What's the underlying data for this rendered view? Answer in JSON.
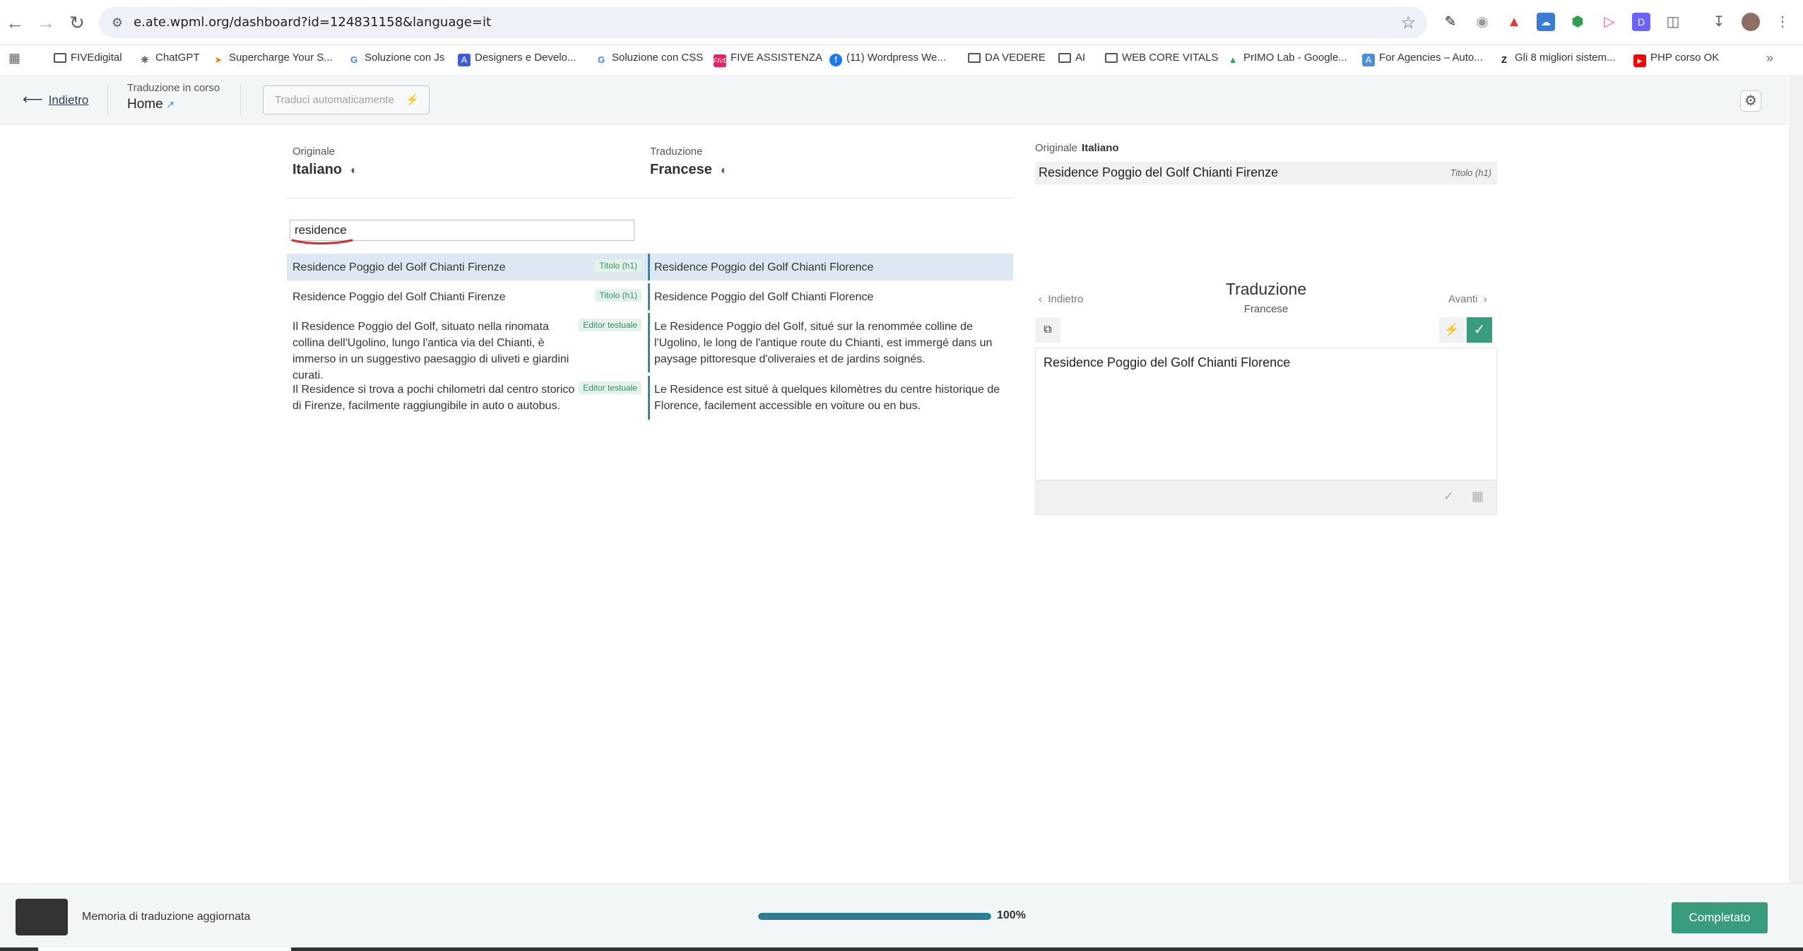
{
  "browser": {
    "url": "e.ate.wpml.org/dashboard?id=124831158&language=it",
    "bookmarks": [
      {
        "label": "FIVEdigital",
        "icon": "folder-icon"
      },
      {
        "label": "ChatGPT",
        "icon": "chatgpt-icon"
      },
      {
        "label": "Supercharge Your S...",
        "icon": "supercharge-icon"
      },
      {
        "label": "Soluzione con Js",
        "icon": "google-icon"
      },
      {
        "label": "Designers e Develo...",
        "icon": "designers-icon"
      },
      {
        "label": "Soluzione con CSS",
        "icon": "google-icon"
      },
      {
        "label": "FIVE ASSISTENZA",
        "icon": "five-icon"
      },
      {
        "label": "(11) Wordpress We...",
        "icon": "facebook-icon"
      },
      {
        "label": "DA VEDERE",
        "icon": "folder-icon"
      },
      {
        "label": "AI",
        "icon": "folder-icon"
      },
      {
        "label": "WEB CORE VITALS",
        "icon": "folder-icon"
      },
      {
        "label": "PrIMO Lab - Google...",
        "icon": "drive-icon"
      },
      {
        "label": "For Agencies – Auto...",
        "icon": "agencies-icon"
      },
      {
        "label": "Gli 8 migliori sistem...",
        "icon": "zendesk-icon"
      },
      {
        "label": "PHP corso OK",
        "icon": "youtube-icon"
      }
    ]
  },
  "header": {
    "back_label": "Indietro",
    "progress_label": "Traduzione in corso",
    "page_name": "Home",
    "auto_translate_label": "Traduci automaticamente"
  },
  "languages": {
    "original_caption": "Originale",
    "original_name": "Italiano",
    "translation_caption": "Traduzione",
    "translation_name": "Francese"
  },
  "search": {
    "value": "residence"
  },
  "rows": [
    {
      "source": "Residence Poggio del Golf Chianti Firenze",
      "badge": "Titolo (h1)",
      "translation": "Residence Poggio del Golf Chianti Florence"
    },
    {
      "source": "Residence Poggio del Golf Chianti Firenze",
      "badge": "Titolo (h1)",
      "translation": "Residence Poggio del Golf Chianti Florence"
    },
    {
      "source": "Il Residence Poggio del Golf, situato nella rinomata collina dell'Ugolino, lungo l'antica via del Chianti, è immerso in un suggestivo paesaggio di uliveti e giardini curati.",
      "badge": "Editor testuale",
      "translation": "Le Residence Poggio del Golf, situé sur la renommée colline de l'Ugolino, le long de l'antique route du Chianti, est immergé dans un paysage pittoresque d'oliveraies et de jardins soignés."
    },
    {
      "source": "Il Residence si trova a pochi chilometri dal centro storico di Firenze, facilmente raggiungibile in auto o autobus.",
      "badge": "Editor testuale",
      "translation": "Le Residence est situé à quelques kilomètres du centre historique de Florence, facilement accessible en voiture ou en bus."
    }
  ],
  "panel": {
    "original_caption": "Originale",
    "original_lang": "Italiano",
    "original_text": "Residence Poggio del Golf Chianti Firenze",
    "original_tag": "Titolo (h1)",
    "title": "Traduzione",
    "subtitle": "Francese",
    "prev_label": "Indietro",
    "next_label": "Avanti",
    "translation_text": "Residence Poggio del Golf Chianti Florence"
  },
  "footer": {
    "message": "Memoria di traduzione aggiornata",
    "progress_percent": 100,
    "progress_text": "100%",
    "done_label": "Completato"
  },
  "colors": {
    "accent": "#3a9c7e",
    "row_highlight": "#dce9f2",
    "progress": "#2e7d95"
  }
}
